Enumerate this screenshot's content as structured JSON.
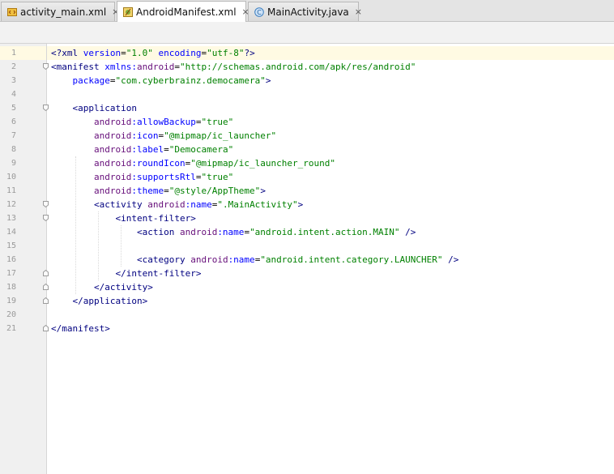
{
  "tabs": [
    {
      "label": "activity_main.xml",
      "icon": "xml-layout-icon",
      "active": false
    },
    {
      "label": "AndroidManifest.xml",
      "icon": "manifest-icon",
      "active": true
    },
    {
      "label": "MainActivity.java",
      "icon": "java-class-icon",
      "active": false
    }
  ],
  "close_glyph": "×",
  "editor": {
    "current_line": 1,
    "lines": [
      {
        "n": "1",
        "tokens": [
          [
            "tag",
            "<?xml "
          ],
          [
            "attr",
            "version"
          ],
          [
            "plain",
            "="
          ],
          [
            "val",
            "\"1.0\""
          ],
          [
            "plain",
            " "
          ],
          [
            "attr",
            "encoding"
          ],
          [
            "plain",
            "="
          ],
          [
            "val",
            "\"utf-8\""
          ],
          [
            "tag",
            "?>"
          ]
        ]
      },
      {
        "n": "2",
        "tokens": [
          [
            "tag",
            "<manifest "
          ],
          [
            "attr",
            "xmlns:"
          ],
          [
            "ns",
            "android"
          ],
          [
            "plain",
            "="
          ],
          [
            "val",
            "\"http://schemas.android.com/apk/res/android\""
          ]
        ]
      },
      {
        "n": "3",
        "tokens": [
          [
            "plain",
            "    "
          ],
          [
            "attr",
            "package"
          ],
          [
            "plain",
            "="
          ],
          [
            "val",
            "\"com.cyberbrainz.democamera\""
          ],
          [
            "tag",
            ">"
          ]
        ]
      },
      {
        "n": "4",
        "tokens": []
      },
      {
        "n": "5",
        "tokens": [
          [
            "plain",
            "    "
          ],
          [
            "tag",
            "<application"
          ]
        ]
      },
      {
        "n": "6",
        "tokens": [
          [
            "plain",
            "        "
          ],
          [
            "ns",
            "android"
          ],
          [
            "attr",
            ":allowBackup"
          ],
          [
            "plain",
            "="
          ],
          [
            "val",
            "\"true\""
          ]
        ]
      },
      {
        "n": "7",
        "tokens": [
          [
            "plain",
            "        "
          ],
          [
            "ns",
            "android"
          ],
          [
            "attr",
            ":icon"
          ],
          [
            "plain",
            "="
          ],
          [
            "val",
            "\"@mipmap/ic_launcher\""
          ]
        ]
      },
      {
        "n": "8",
        "tokens": [
          [
            "plain",
            "        "
          ],
          [
            "ns",
            "android"
          ],
          [
            "attr",
            ":label"
          ],
          [
            "plain",
            "="
          ],
          [
            "val",
            "\"Democamera\""
          ]
        ]
      },
      {
        "n": "9",
        "tokens": [
          [
            "plain",
            "        "
          ],
          [
            "ns",
            "android"
          ],
          [
            "attr",
            ":roundIcon"
          ],
          [
            "plain",
            "="
          ],
          [
            "val",
            "\"@mipmap/ic_launcher_round\""
          ]
        ]
      },
      {
        "n": "10",
        "tokens": [
          [
            "plain",
            "        "
          ],
          [
            "ns",
            "android"
          ],
          [
            "attr",
            ":supportsRtl"
          ],
          [
            "plain",
            "="
          ],
          [
            "val",
            "\"true\""
          ]
        ]
      },
      {
        "n": "11",
        "tokens": [
          [
            "plain",
            "        "
          ],
          [
            "ns",
            "android"
          ],
          [
            "attr",
            ":theme"
          ],
          [
            "plain",
            "="
          ],
          [
            "val",
            "\"@style/AppTheme\""
          ],
          [
            "tag",
            ">"
          ]
        ]
      },
      {
        "n": "12",
        "tokens": [
          [
            "plain",
            "        "
          ],
          [
            "tag",
            "<activity "
          ],
          [
            "ns",
            "android"
          ],
          [
            "attr",
            ":name"
          ],
          [
            "plain",
            "="
          ],
          [
            "val",
            "\".MainActivity\""
          ],
          [
            "tag",
            ">"
          ]
        ]
      },
      {
        "n": "13",
        "tokens": [
          [
            "plain",
            "            "
          ],
          [
            "tag",
            "<intent-filter>"
          ]
        ]
      },
      {
        "n": "14",
        "tokens": [
          [
            "plain",
            "                "
          ],
          [
            "tag",
            "<action "
          ],
          [
            "ns",
            "android"
          ],
          [
            "attr",
            ":name"
          ],
          [
            "plain",
            "="
          ],
          [
            "val",
            "\"android.intent.action.MAIN\""
          ],
          [
            "tag",
            " />"
          ]
        ]
      },
      {
        "n": "15",
        "tokens": []
      },
      {
        "n": "16",
        "tokens": [
          [
            "plain",
            "                "
          ],
          [
            "tag",
            "<category "
          ],
          [
            "ns",
            "android"
          ],
          [
            "attr",
            ":name"
          ],
          [
            "plain",
            "="
          ],
          [
            "val",
            "\"android.intent.category.LAUNCHER\""
          ],
          [
            "tag",
            " />"
          ]
        ]
      },
      {
        "n": "17",
        "tokens": [
          [
            "plain",
            "            "
          ],
          [
            "tag",
            "</intent-filter>"
          ]
        ]
      },
      {
        "n": "18",
        "tokens": [
          [
            "plain",
            "        "
          ],
          [
            "tag",
            "</activity>"
          ]
        ]
      },
      {
        "n": "19",
        "tokens": [
          [
            "plain",
            "    "
          ],
          [
            "tag",
            "</application>"
          ]
        ]
      },
      {
        "n": "20",
        "tokens": []
      },
      {
        "n": "21",
        "tokens": [
          [
            "tag",
            "</manifest>"
          ]
        ]
      }
    ]
  },
  "colors": {
    "tag": "#000080",
    "attr": "#0000ff",
    "namespace": "#660e7a",
    "value": "#008000",
    "current_line": "#fffae3"
  }
}
